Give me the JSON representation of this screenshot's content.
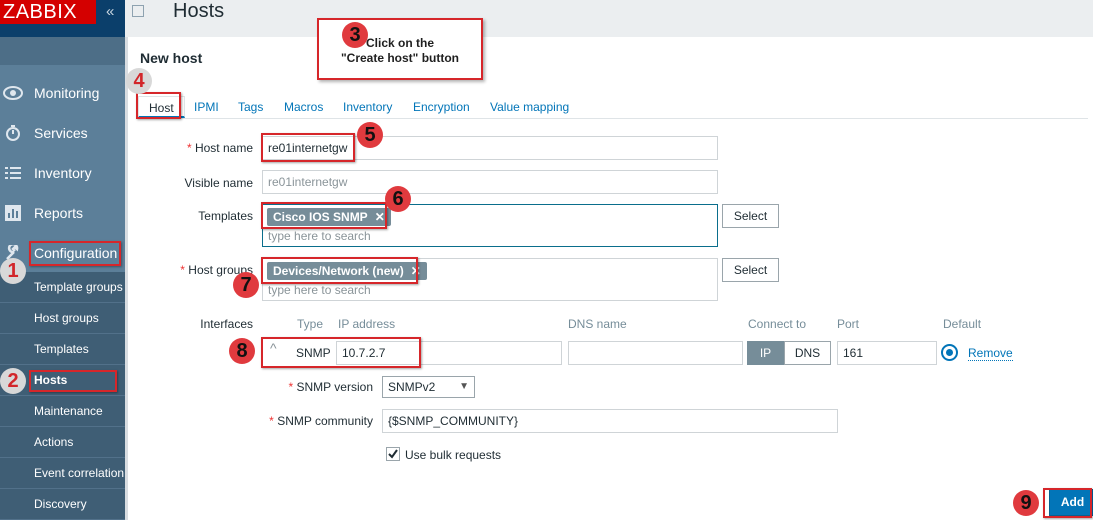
{
  "sidebar": {
    "logo": "ZABBIX",
    "menu": [
      {
        "label": "Monitoring",
        "icon": "eye-icon"
      },
      {
        "label": "Services",
        "icon": "stopwatch-icon"
      },
      {
        "label": "Inventory",
        "icon": "list-icon"
      },
      {
        "label": "Reports",
        "icon": "bar-chart-icon"
      },
      {
        "label": "Configuration",
        "icon": "wrench-icon"
      }
    ],
    "submenu": [
      "Template groups",
      "Host groups",
      "Templates",
      "Hosts",
      "Maintenance",
      "Actions",
      "Event correlation",
      "Discovery"
    ]
  },
  "header": {
    "title": "Hosts"
  },
  "form": {
    "title": "New host",
    "tabs": [
      "Host",
      "IPMI",
      "Tags",
      "Macros",
      "Inventory",
      "Encryption",
      "Value mapping"
    ],
    "host_name": {
      "label": "Host name",
      "required_mark": "*",
      "value": "re01internetgw"
    },
    "visible_name": {
      "label": "Visible name",
      "placeholder": "re01internetgw"
    },
    "templates": {
      "label": "Templates",
      "chip": "Cisco IOS SNMP",
      "placeholder": "type here to search",
      "select_label": "Select"
    },
    "host_groups": {
      "label": "Host groups",
      "required_mark": "*",
      "chip": "Devices/Network (new)",
      "placeholder": "type here to search",
      "select_label": "Select"
    },
    "interfaces": {
      "label": "Interfaces",
      "columns": {
        "type": "Type",
        "ip": "IP address",
        "dns": "DNS name",
        "connect": "Connect to",
        "port": "Port",
        "default": "Default"
      },
      "row": {
        "type": "SNMP",
        "ip": "10.7.2.7",
        "dns": "",
        "connect_ip": "IP",
        "connect_dns": "DNS",
        "port": "161",
        "remove": "Remove"
      }
    },
    "snmp_version": {
      "label": "SNMP version",
      "required_mark": "*",
      "value": "SNMPv2"
    },
    "snmp_community": {
      "label": "SNMP community",
      "required_mark": "*",
      "value": "{$SNMP_COMMUNITY}"
    },
    "bulk": {
      "label": "Use bulk requests",
      "checked": true
    },
    "add_label": "Add"
  },
  "annotations": {
    "callout": "Click on the\n\"Create host\" button",
    "callout_line1": "Click on the",
    "callout_line2": "\"Create host\" button",
    "steps": [
      "1",
      "2",
      "3",
      "4",
      "5",
      "6",
      "7",
      "8",
      "9"
    ]
  },
  "colors": {
    "accent": "#0275b8",
    "sidebar": "#5c7f99",
    "highlight": "#d6262a"
  }
}
